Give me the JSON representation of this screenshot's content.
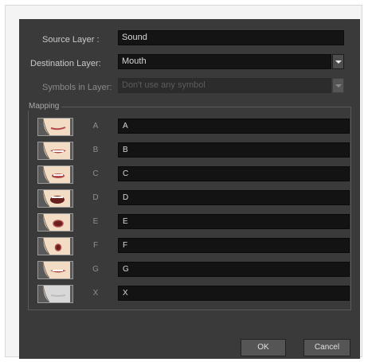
{
  "form": {
    "source_layer_label": "Source Layer :",
    "source_layer_value": "Sound",
    "destination_layer_label": "Destination Layer:",
    "destination_layer_value": "Mouth",
    "symbols_label": "Symbols in Layer:",
    "symbols_value": "Don't use any symbol"
  },
  "mapping": {
    "title": "Mapping",
    "rows": [
      {
        "letter": "A",
        "value": "A",
        "mouth": "mouth-closed-icon"
      },
      {
        "letter": "B",
        "value": "B",
        "mouth": "mouth-teeth-icon"
      },
      {
        "letter": "C",
        "value": "C",
        "mouth": "mouth-slightly-open-icon"
      },
      {
        "letter": "D",
        "value": "D",
        "mouth": "mouth-wide-open-icon"
      },
      {
        "letter": "E",
        "value": "E",
        "mouth": "mouth-rounded-icon"
      },
      {
        "letter": "F",
        "value": "F",
        "mouth": "mouth-oo-icon"
      },
      {
        "letter": "G",
        "value": "G",
        "mouth": "mouth-fv-icon"
      },
      {
        "letter": "X",
        "value": "X",
        "mouth": "mouth-rest-icon"
      }
    ]
  },
  "buttons": {
    "ok": "OK",
    "cancel": "Cancel"
  },
  "colors": {
    "dialog_bg": "#3a3a3a",
    "field_bg": "#141414",
    "skin": "#f2dcc4",
    "lip": "#b04a4a"
  }
}
